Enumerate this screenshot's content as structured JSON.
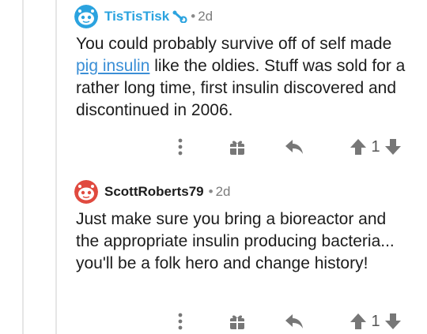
{
  "comments": [
    {
      "username": "TisTisTisk",
      "separator": "•",
      "age": "2d",
      "text_before": "You could probably survive off of self made ",
      "link_text": "pig insulin",
      "text_after": " like the oldies. Stuff was sold for a rather long time, first insulin discovered and discontinued in 2006.",
      "score": "1",
      "avatar_color": "#2ba3df",
      "username_color": "#2ba3df",
      "is_moderator": true
    },
    {
      "username": "ScottRoberts79",
      "separator": "•",
      "age": "2d",
      "text": "Just make sure you bring a bioreactor and the appropriate insulin producing bacteria... you'll be a folk hero and change history!",
      "score": "1",
      "avatar_color": "#e04a3f",
      "username_color": "#1c1c1c"
    }
  ],
  "icons": {
    "more": "vertical-ellipsis-icon",
    "award": "gift-icon",
    "reply": "reply-arrow-icon",
    "upvote": "arrow-up-icon",
    "downvote": "arrow-down-icon"
  },
  "colors": {
    "link": "#3b8fd6",
    "icon": "#777777",
    "thread_line": "#e6e6e6"
  }
}
